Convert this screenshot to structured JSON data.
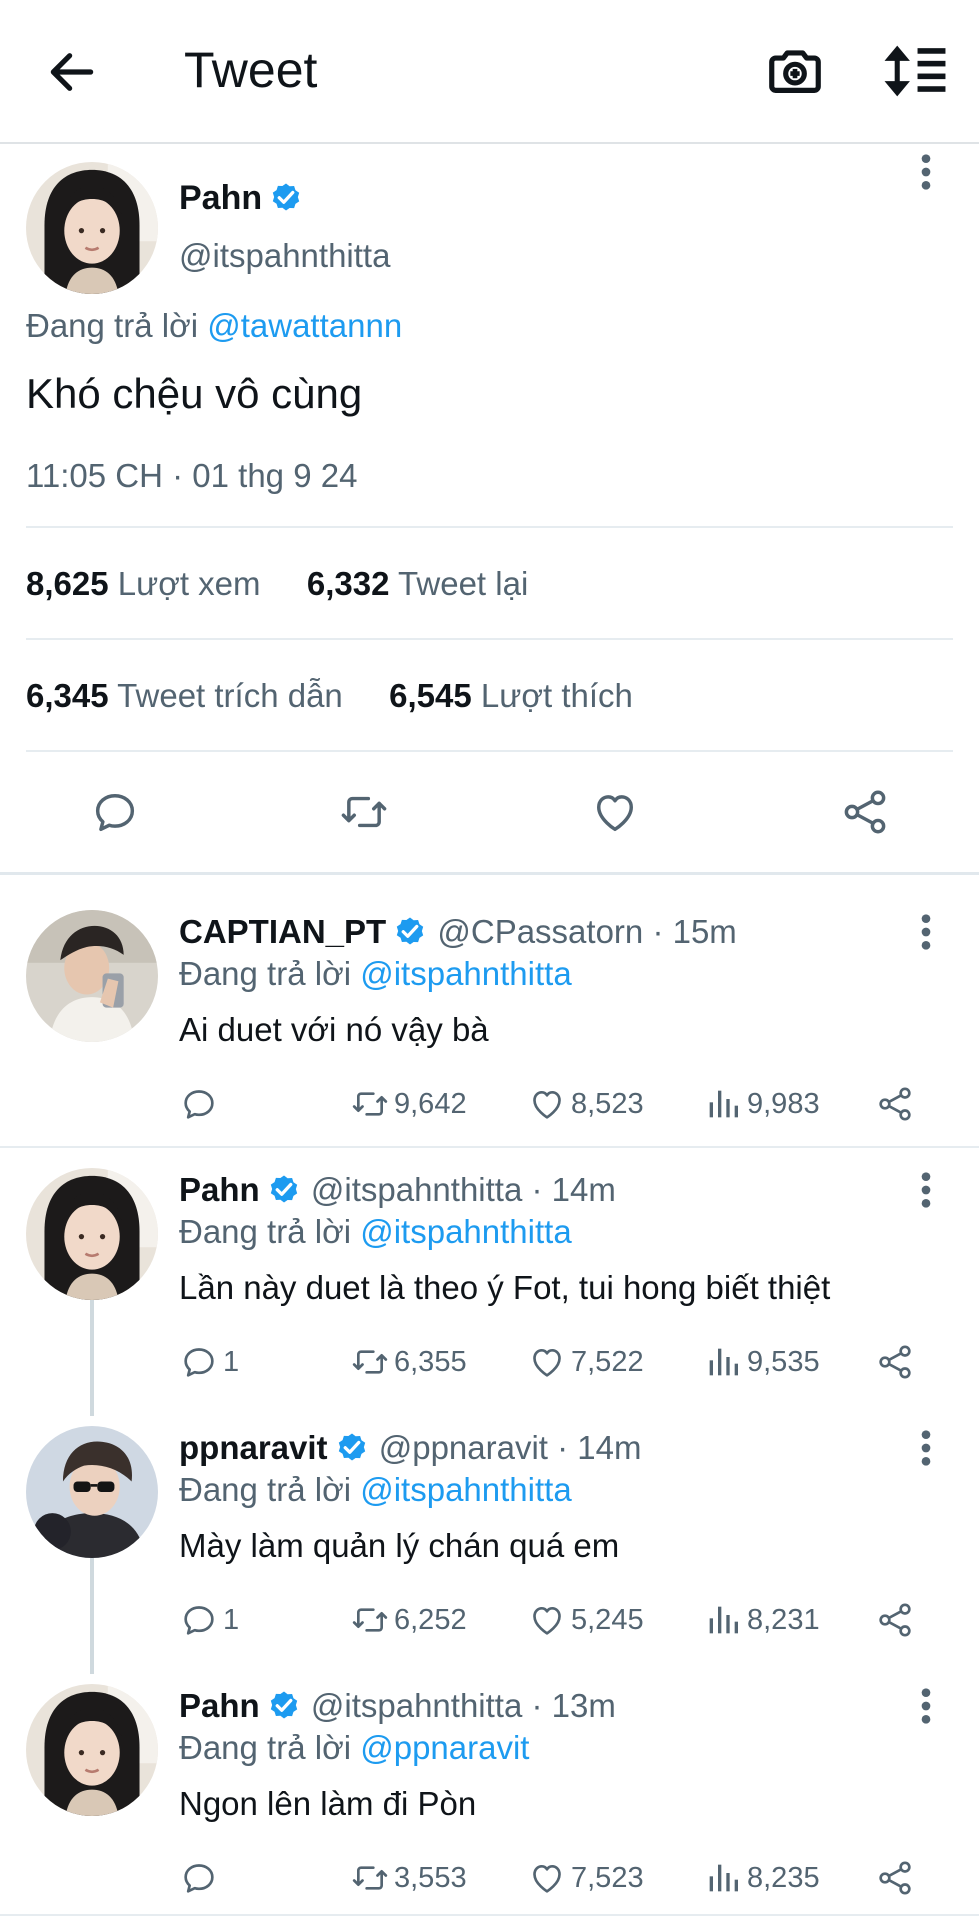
{
  "header": {
    "title": "Tweet",
    "back_icon": "arrow-left-icon",
    "camera_icon": "camera-plus-icon",
    "sort_icon": "sort-lines-icon"
  },
  "main_tweet": {
    "name": "Pahn",
    "handle": "@itspahnthitta",
    "replying_prefix": "Đang trả lời",
    "replying_to": "@tawattannn",
    "text": "Khó chệu vô cùng",
    "timestamp": "11:05 CH · 01 thg 9 24",
    "stats": {
      "views_count": "8,625",
      "views_label": "Lượt xem",
      "retweets_count": "6,332",
      "retweets_label": "Tweet lại",
      "quotes_count": "6,345",
      "quotes_label": "Tweet trích dẫn",
      "likes_count": "6,545",
      "likes_label": "Lượt thích"
    }
  },
  "replies": [
    {
      "name": "CAPTIAN_PT",
      "handle_time": "@CPassatorn · 15m",
      "replying_prefix": "Đang trả lời",
      "replying_to": "@itspahnthitta",
      "text": "Ai duet với nó vậy bà",
      "reply_count": "",
      "retweet_count": "9,642",
      "like_count": "8,523",
      "view_count": "9,983"
    },
    {
      "name": "Pahn",
      "handle_time": "@itspahnthitta · 14m",
      "replying_prefix": "Đang trả lời",
      "replying_to": "@itspahnthitta",
      "text": "Lần này duet là theo ý Fot, tui hong biết thiệt",
      "reply_count": "1",
      "retweet_count": "6,355",
      "like_count": "7,522",
      "view_count": "9,535"
    },
    {
      "name": "ppnaravit",
      "handle_time": "@ppnaravit · 14m",
      "replying_prefix": "Đang trả lời",
      "replying_to": "@itspahnthitta",
      "text": "Mày làm quản lý chán quá em",
      "reply_count": "1",
      "retweet_count": "6,252",
      "like_count": "5,245",
      "view_count": "8,231"
    },
    {
      "name": "Pahn",
      "handle_time": "@itspahnthitta · 13m",
      "replying_prefix": "Đang trả lời",
      "replying_to": "@ppnaravit",
      "text": "Ngon lên làm đi Pòn",
      "reply_count": "",
      "retweet_count": "3,553",
      "like_count": "7,523",
      "view_count": "8,235"
    }
  ],
  "colors": {
    "accent": "#1d9bf0",
    "secondary_text": "#536471",
    "divider": "#e6ecf0"
  }
}
